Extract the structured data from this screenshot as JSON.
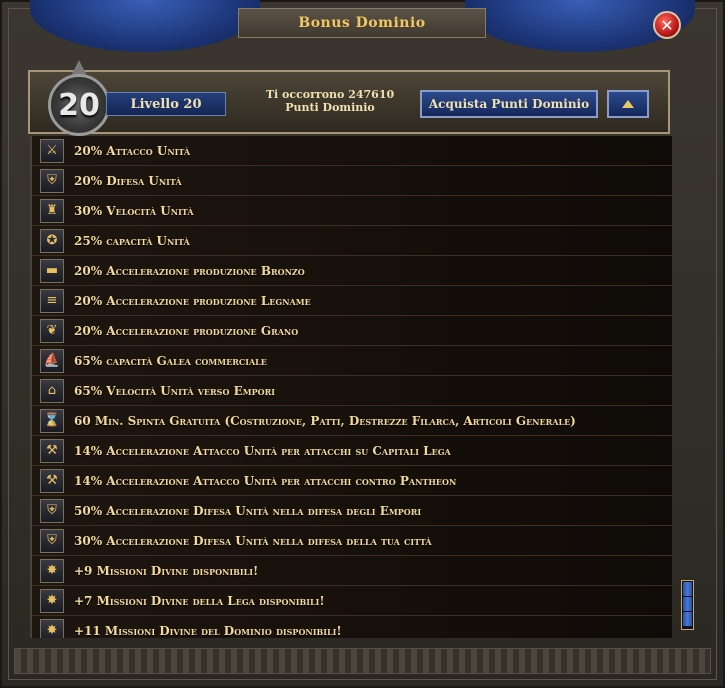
{
  "window": {
    "title": "Bonus Dominio",
    "close_icon": "close-icon"
  },
  "header": {
    "level_number": "20",
    "level_label": "Livello 20",
    "need_line1": "Ti occorrono 247610",
    "need_line2": "Punti Dominio",
    "buy_button": "Acquista Punti Dominio"
  },
  "bonuses": [
    {
      "icon": "swords-icon",
      "glyph": "⚔",
      "text": "20% Attacco Unità"
    },
    {
      "icon": "shield-icon",
      "glyph": "⛨",
      "text": "20% Difesa Unità"
    },
    {
      "icon": "helmet-icon",
      "glyph": "♜",
      "text": "30% Velocità Unità"
    },
    {
      "icon": "sack-icon",
      "glyph": "✪",
      "text": "25% capacità Unità"
    },
    {
      "icon": "bronze-icon",
      "glyph": "▬",
      "text": "20% Accelerazione produzione Bronzo"
    },
    {
      "icon": "timber-icon",
      "glyph": "≡",
      "text": "20% Accelerazione produzione Legname"
    },
    {
      "icon": "grain-icon",
      "glyph": "❦",
      "text": "20% Accelerazione produzione Grano"
    },
    {
      "icon": "galley-icon",
      "glyph": "⛵",
      "text": "65% capacità Galea commerciale"
    },
    {
      "icon": "emporium-icon",
      "glyph": "⌂",
      "text": "65% Velocità Unità verso Empori"
    },
    {
      "icon": "hourglass-icon",
      "glyph": "⌛",
      "text": "60 Min. Spinta Gratuita (Costruzione, Patti, Destrezze Filarca, Articoli Generale)"
    },
    {
      "icon": "capital-attack-icon",
      "glyph": "⚒",
      "text": "14% Accelerazione Attacco Unità per attacchi su Capitali Lega"
    },
    {
      "icon": "pantheon-attack-icon",
      "glyph": "⚒",
      "text": "14% Accelerazione Attacco Unità per attacchi contro Pantheon"
    },
    {
      "icon": "emporium-defense-icon",
      "glyph": "⛨",
      "text": "50% Accelerazione Difesa Unità nella difesa degli Empori"
    },
    {
      "icon": "city-defense-icon",
      "glyph": "⛨",
      "text": "30% Accelerazione Difesa Unità nella difesa della tua città"
    },
    {
      "icon": "divine-mission-icon",
      "glyph": "✸",
      "text": "+9 Missioni Divine disponibili!"
    },
    {
      "icon": "league-mission-icon",
      "glyph": "✸",
      "text": "+7 Missioni Divine della Lega disponibili!"
    },
    {
      "icon": "domain-mission-icon",
      "glyph": "✸",
      "text": "+11 Missioni Divine del Dominio disponibili!"
    }
  ],
  "colors": {
    "accent_gold": "#f0c860",
    "button_blue": "#1c3577",
    "text_cream": "#f3d99a"
  }
}
